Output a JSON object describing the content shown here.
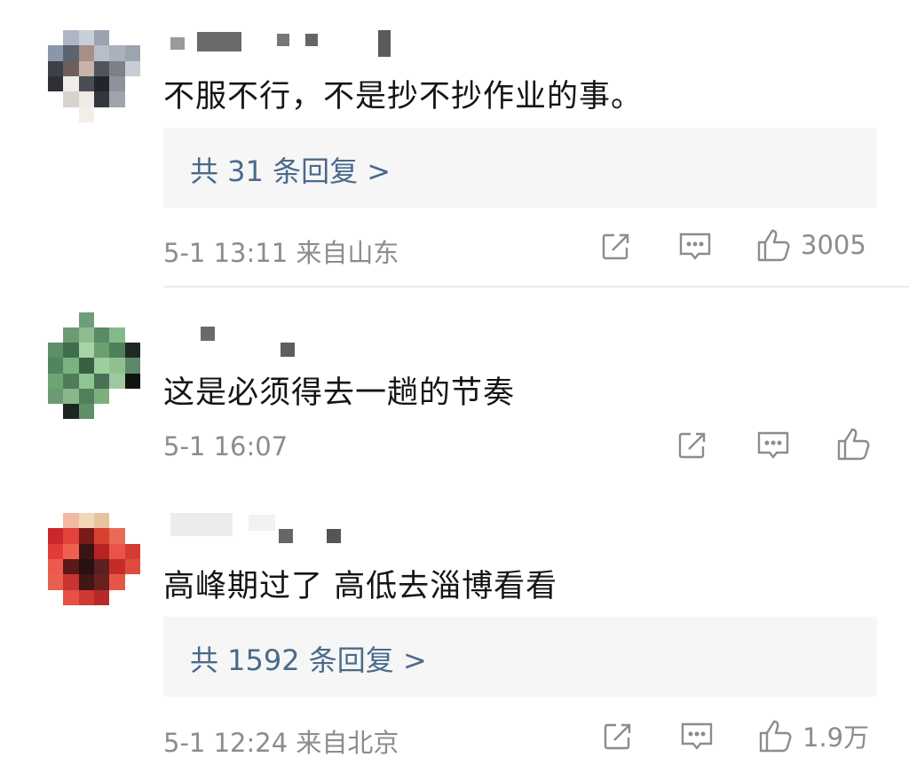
{
  "comments": [
    {
      "text": "不服不行，不是抄不抄作业的事。",
      "replies": "共 31 条回复 >",
      "meta": "5-1 13:11 来自山东",
      "like_count": "3005"
    },
    {
      "text": "这是必须得去一趟的节奏",
      "meta": "5-1 16:07",
      "like_count": ""
    },
    {
      "text": "高峰期过了 高低去淄博看看",
      "replies": "共 1592 条回复 >",
      "meta": "5-1 12:24 来自北京",
      "like_count": "1.9万"
    }
  ],
  "icons": {
    "share": "share-icon",
    "comment": "comment-icon",
    "like": "thumbs-up-icon"
  },
  "colors": {
    "reply_link": "#4a6a8c",
    "meta": "#8c8c8c",
    "reply_bg": "#f6f6f6"
  }
}
